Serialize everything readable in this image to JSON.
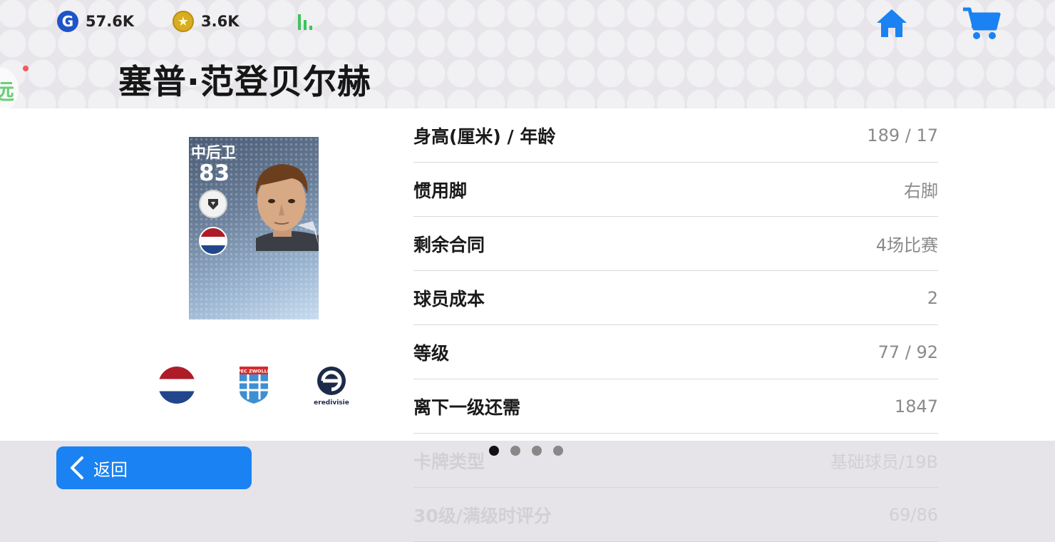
{
  "header": {
    "gp_value": "57.6K",
    "coins_value": "3.6K",
    "title": "塞普·范登贝尔赫",
    "side_tab_glyph": "远"
  },
  "icons": {
    "gp": "gp-currency-icon",
    "coin": "star-coin-icon",
    "signal": "signal-icon",
    "home": "home-icon",
    "cart": "cart-icon",
    "back": "chevron-left-icon"
  },
  "card": {
    "position": "中后卫",
    "rating": "83",
    "nationality_flag": "netherlands-flag-icon",
    "club": "pec-zwolle-crest",
    "club_text": "PEC ZWOLLE",
    "league": "eredivisie-logo",
    "league_text": "eredivisie"
  },
  "stats": [
    {
      "label": "身高(厘米) / 年龄",
      "value": "189 / 17"
    },
    {
      "label": "惯用脚",
      "value": "右脚"
    },
    {
      "label": "剩余合同",
      "value": "4场比赛"
    },
    {
      "label": "球员成本",
      "value": "2"
    },
    {
      "label": "等级",
      "value": "77 / 92"
    },
    {
      "label": "离下一级还需",
      "value": "1847"
    },
    {
      "label": "卡牌类型",
      "value": "基础球员/19B"
    },
    {
      "label": "30级/满级时评分",
      "value": "69/86"
    }
  ],
  "pager": {
    "count": 4,
    "active": 0
  },
  "footer": {
    "back_label": "返回"
  },
  "colors": {
    "accent_blue": "#1a82f2",
    "gp_blue": "#1f54c8",
    "coin_gold": "#d9ad20",
    "signal_green": "#3cc45a",
    "header_bg": "#e7e5ea"
  }
}
